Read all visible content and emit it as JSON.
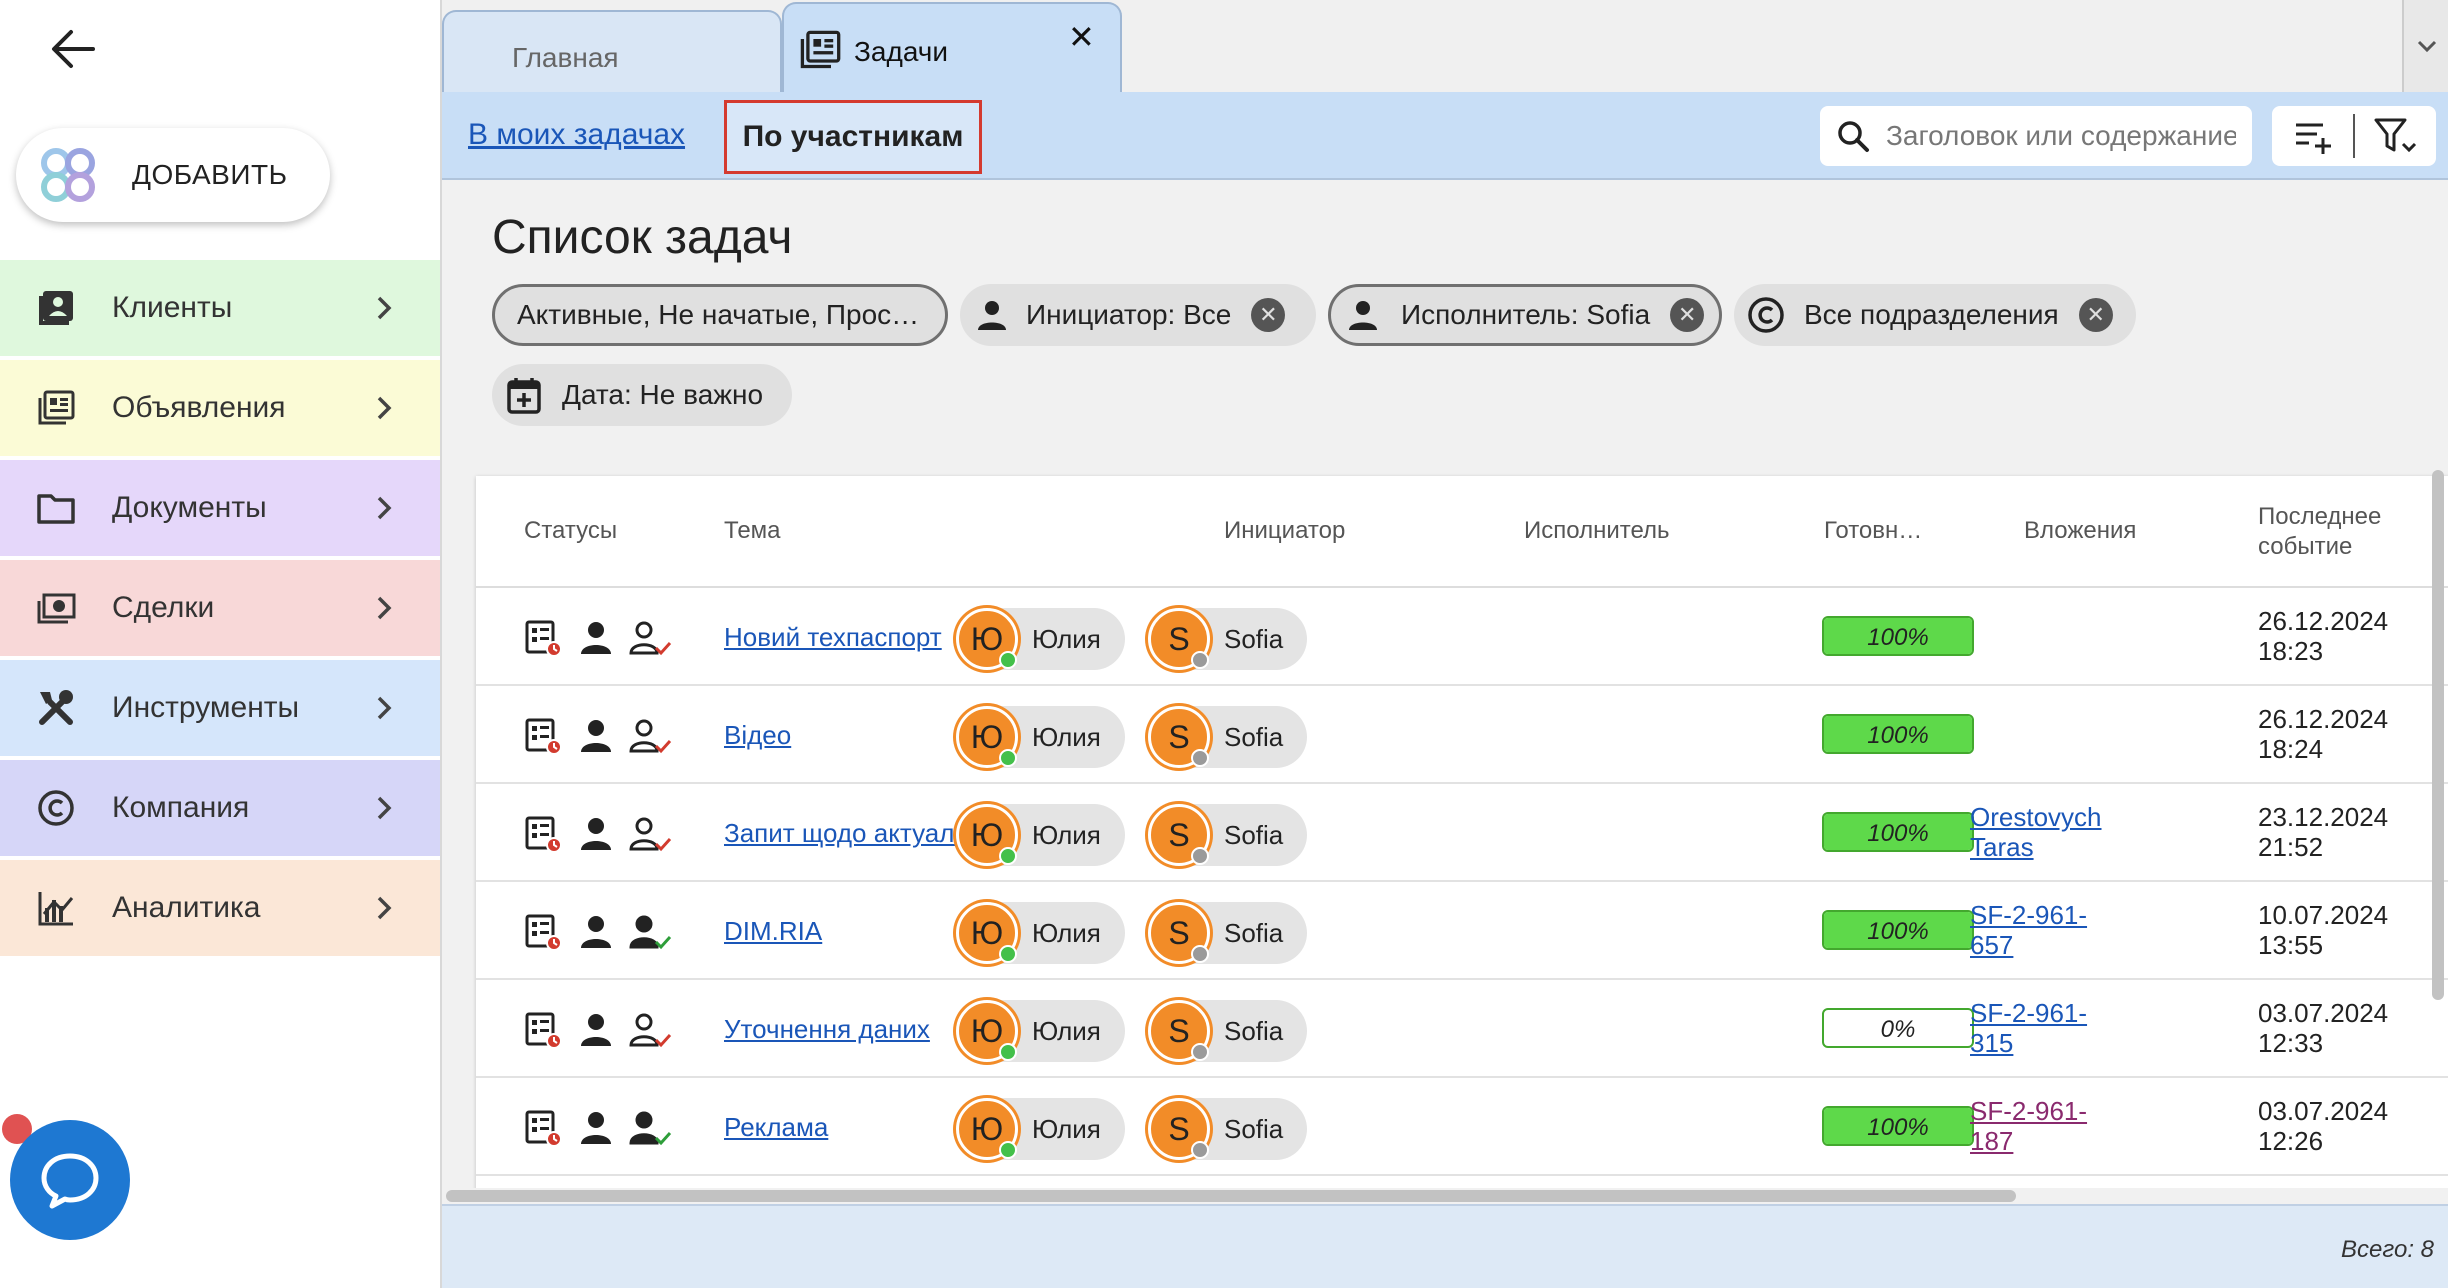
{
  "sidebar": {
    "add_label": "ДОБАВИТЬ",
    "items": [
      {
        "label": "Клиенты",
        "icon": "contacts-icon",
        "color": "#dff8dd"
      },
      {
        "label": "Объявления",
        "icon": "listings-icon",
        "color": "#fbfbd6"
      },
      {
        "label": "Документы",
        "icon": "folder-icon",
        "color": "#e5d7fa"
      },
      {
        "label": "Сделки",
        "icon": "money-icon",
        "color": "#f8d8d8"
      },
      {
        "label": "Инструменты",
        "icon": "tools-icon",
        "color": "#d5e6fb"
      },
      {
        "label": "Компания",
        "icon": "copyright-icon",
        "color": "#d6d6f8"
      },
      {
        "label": "Аналитика",
        "icon": "analytics-icon",
        "color": "#fbe7d7"
      }
    ]
  },
  "tabs": {
    "home": "Главная",
    "tasks": "Задачи"
  },
  "subnav": {
    "my_tasks": "В моих задачах",
    "by_participants": "По участникам",
    "search_placeholder": "Заголовок или содержание"
  },
  "page_title": "Список задач",
  "filters": {
    "status": "Активные, Не начатые, Прос…",
    "initiator": "Инициатор: Все",
    "executor": "Исполнитель: Sofia",
    "departments": "Все подразделения",
    "date": "Дата: Не важно"
  },
  "table": {
    "headers": {
      "statuses": "Статусы",
      "topic": "Тема",
      "initiator": "Инициатор",
      "executor": "Исполнитель",
      "ready": "Готовн…",
      "attachments": "Вложения",
      "last_event_1": "Последнее",
      "last_event_2": "событие"
    },
    "rows": [
      {
        "topic": "Новий техпаспорт",
        "init_letter": "Ю",
        "init_name": "Юлия",
        "exec_letter": "S",
        "exec_name": "Sofia",
        "progress": 100,
        "progress_label": "100%",
        "attach_1": "",
        "attach_2": "",
        "attach_color": "#1a56b8",
        "date": "26.12.2024",
        "time": "18:23",
        "exec_check": "red"
      },
      {
        "topic": "Відео",
        "init_letter": "Ю",
        "init_name": "Юлия",
        "exec_letter": "S",
        "exec_name": "Sofia",
        "progress": 100,
        "progress_label": "100%",
        "attach_1": "",
        "attach_2": "",
        "attach_color": "#1a56b8",
        "date": "26.12.2024",
        "time": "18:24",
        "exec_check": "red"
      },
      {
        "topic": "Запит щодо актуальності",
        "init_letter": "Ю",
        "init_name": "Юлия",
        "exec_letter": "S",
        "exec_name": "Sofia",
        "progress": 100,
        "progress_label": "100%",
        "attach_1": "Orestovych",
        "attach_2": "Taras",
        "attach_color": "#1a56b8",
        "date": "23.12.2024",
        "time": "21:52",
        "exec_check": "red"
      },
      {
        "topic": "DIM.RIA",
        "init_letter": "Ю",
        "init_name": "Юлия",
        "exec_letter": "S",
        "exec_name": "Sofia",
        "progress": 100,
        "progress_label": "100%",
        "attach_1": "SF-2-961-",
        "attach_2": "657",
        "attach_color": "#1a56b8",
        "date": "10.07.2024",
        "time": "13:55",
        "exec_check": "green"
      },
      {
        "topic": "Уточнення даних",
        "init_letter": "Ю",
        "init_name": "Юлия",
        "exec_letter": "S",
        "exec_name": "Sofia",
        "progress": 0,
        "progress_label": "0%",
        "attach_1": "SF-2-961-",
        "attach_2": "315",
        "attach_color": "#1a56b8",
        "date": "03.07.2024",
        "time": "12:33",
        "exec_check": "red"
      },
      {
        "topic": "Реклама",
        "init_letter": "Ю",
        "init_name": "Юлия",
        "exec_letter": "S",
        "exec_name": "Sofia",
        "progress": 100,
        "progress_label": "100%",
        "attach_1": "SF-2-961-",
        "attach_2": "187",
        "attach_color": "#8a2a6e",
        "date": "03.07.2024",
        "time": "12:26",
        "exec_check": "green"
      }
    ]
  },
  "footer": {
    "total": "Всего: 8"
  },
  "colors": {
    "accent": "#1a56b8",
    "online": "#43c04a",
    "offline": "#9a9a9a",
    "avatar": "#f28c28",
    "progress": "#5ed94a"
  }
}
